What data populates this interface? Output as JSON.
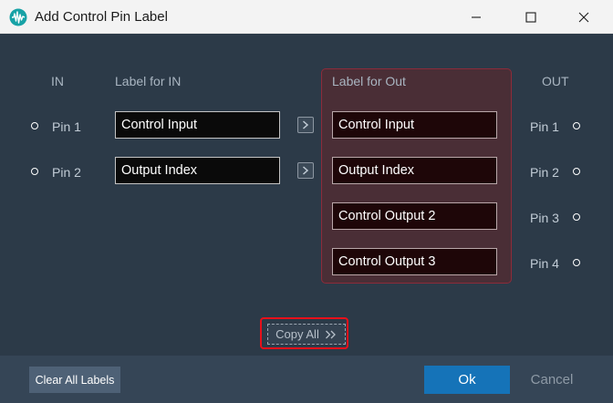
{
  "window": {
    "title": "Add Control Pin Label",
    "app_icon": "audio-waveform-icon"
  },
  "headers": {
    "in": "IN",
    "label_in": "Label for IN",
    "label_out": "Label for Out",
    "out": "OUT"
  },
  "in_pins": [
    {
      "pin": "Pin 1",
      "label": "Control Input"
    },
    {
      "pin": "Pin 2",
      "label": "Output Index"
    }
  ],
  "out_pins": [
    {
      "pin": "Pin 1",
      "label": "Control Input"
    },
    {
      "pin": "Pin 2",
      "label": "Output Index"
    },
    {
      "pin": "Pin 3",
      "label": "Control Output 2"
    },
    {
      "pin": "Pin 4",
      "label": "Control Output 3"
    }
  ],
  "actions": {
    "copy_all": "Copy All",
    "clear_all": "Clear All Labels",
    "ok": "Ok",
    "cancel": "Cancel"
  },
  "colors": {
    "accent": "#1573b8",
    "highlight": "#e8101a",
    "out_panel_border": "#8d2b3a"
  }
}
